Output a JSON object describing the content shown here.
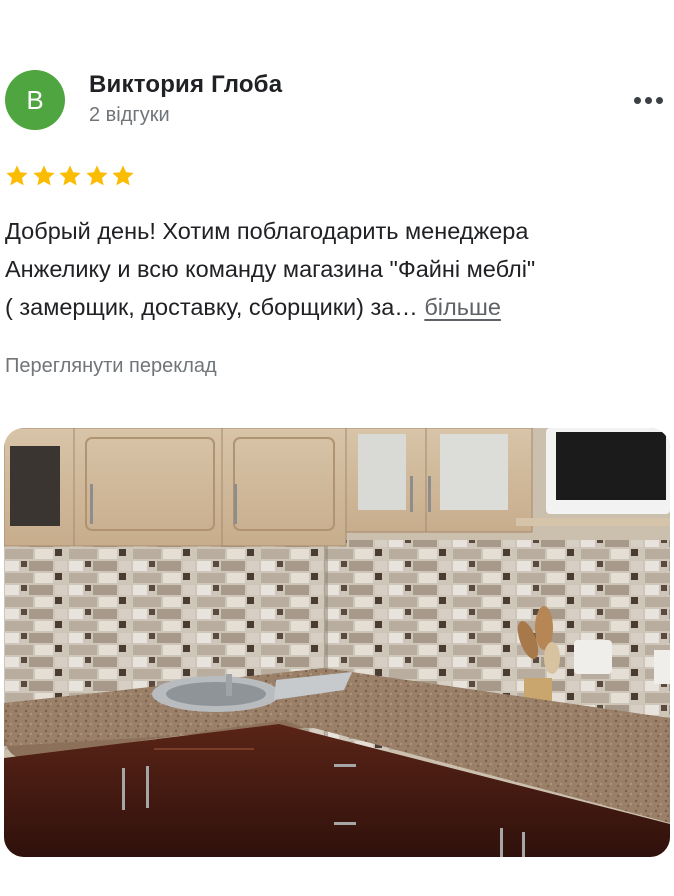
{
  "review": {
    "author": {
      "initial": "В",
      "name": "Виктория Глоба",
      "reviews_count": "2 відгуки",
      "avatar_color": "#4fa53f"
    },
    "more_options_icon": "more-horizontal-icon",
    "rating": 5,
    "rating_max": 5,
    "star_color": "#fbbc04",
    "text_lines": [
      "Добрый день! Хотим поблагодарить менеджера",
      "Анжелику и всю команду магазина \"Файні меблі\"",
      "( замерщик, доставку, сборщики) за… "
    ],
    "more_link": "більше",
    "translate_link": "Переглянути переклад",
    "photo": {
      "subject": "kitchen-photo"
    }
  }
}
